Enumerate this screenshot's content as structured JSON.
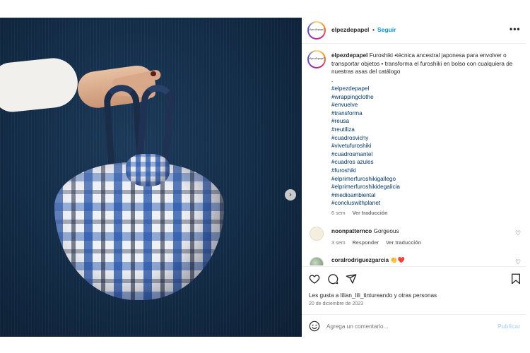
{
  "post": {
    "username": "elpezdepapel",
    "follow_separator": "•",
    "follow_label": "Seguir",
    "more_label": "•••",
    "avatar_logo": "elpezdepapel",
    "caption_user": "elpezdepapel",
    "caption_text": "Furoshiki •técnica ancestral japonesa para envolver o transportar objetos • transforma el furoshiki en bolso con cualquiera de nuestras asas del catálogo",
    "caption_dot": ".",
    "hashtags": [
      "#elpezdepapel",
      "#wrappingclothe",
      "#envuelve",
      "#transforma",
      "#reusa",
      "#reutiliza",
      "#cuadrosvichy",
      "#vivetufuroshiki",
      "#cuadrosmantel",
      "#cuadros azules",
      "#furoshiki",
      "#elprimerfuroshikigallego",
      "#elprimerfuroshikidegalicia",
      "#medioambiental",
      "#concluswithplanet"
    ],
    "caption_time": "6 sem",
    "caption_translate": "Ver traducción",
    "likes_text": "Les gusta a lilian_lili_tintureando y otras personas",
    "date": "20 de diciembre de 2023"
  },
  "comments": [
    {
      "user": "noonpatternco",
      "text": "Gorgeous",
      "time": "3 sem",
      "reply_label": "Responder",
      "translate_label": "Ver traducción"
    },
    {
      "user": "coralrodriguezgarcia",
      "text": "👏❤️"
    }
  ],
  "comment_box": {
    "placeholder": "Agrega un comentario...",
    "publish_label": "Publicar"
  },
  "media": {
    "next_arrow": "›",
    "dots": 3,
    "active_dot": 0
  },
  "icons": {
    "like": "heart-icon",
    "comment": "comment-icon",
    "share": "share-icon",
    "save": "bookmark-icon",
    "emoji": "emoji-icon"
  }
}
